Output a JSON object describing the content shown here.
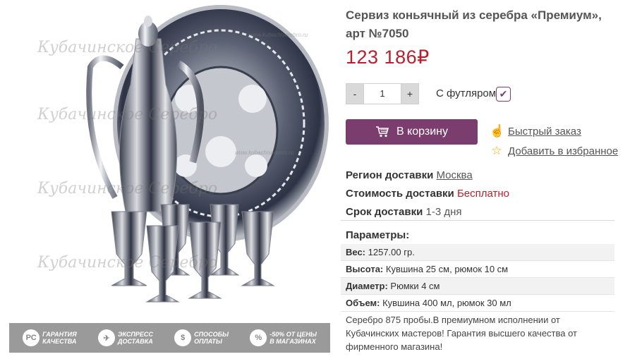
{
  "product": {
    "title": "Сервиз коньячный из серебра «Премиум», арт №7050",
    "price": "123 186₽",
    "quantity": "1",
    "qty_minus": "-",
    "qty_plus": "+",
    "case_label": "С футляром",
    "case_checked": true,
    "cart_button": "В корзину",
    "quick_order": "Быстрый заказ",
    "add_favorite": "Добавить в избранное"
  },
  "delivery": {
    "region_label": "Регион доставки",
    "region_value": "Москва",
    "cost_label": "Стоимость доставки",
    "cost_value": "Бесплатно",
    "time_label": "Срок доставки",
    "time_value": "1-3 дня"
  },
  "params": {
    "title": "Параметры:",
    "rows": [
      {
        "label": "Вес:",
        "value": "1257.00 гр."
      },
      {
        "label": "Высота:",
        "value": "Кувшина 25 см, рюмок 10 см"
      },
      {
        "label": "Диаметр:",
        "value": "Рюмки 4 см"
      },
      {
        "label": "Объем:",
        "value": "Кувшина 400 мл, рюмок 30 мл"
      }
    ]
  },
  "description": "Серебро 875 пробы.В премиумном исполнении от Кубачинских мастеров! Гарантия высшего качества от фирменного магазина!",
  "gallery": {
    "watermark": "Кубачинское Серебро",
    "watermark_url": "www.kubachiserebro.ru",
    "benefits": [
      {
        "icon": "РС",
        "text": "Гарантия\nкачества"
      },
      {
        "icon": "✈",
        "text": "Экспресс\nдоставка"
      },
      {
        "icon": "$",
        "text": "Способы\nоплаты"
      },
      {
        "icon": "%",
        "text": "-50% от цены\nв магазинах"
      }
    ]
  },
  "colors": {
    "accent": "#7b3d6e",
    "price": "#b8202d",
    "star": "#e0b400"
  }
}
